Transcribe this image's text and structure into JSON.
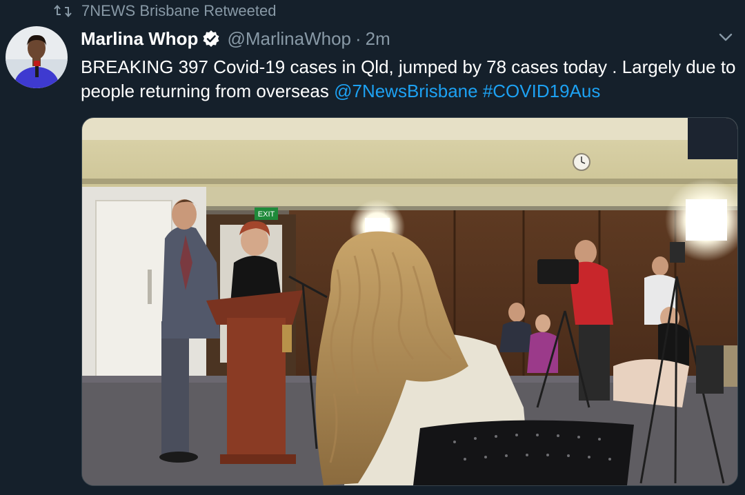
{
  "retweet": {
    "icon": "retweet-icon",
    "label": "7NEWS Brisbane Retweeted"
  },
  "author": {
    "display_name": "Marlina Whop",
    "verified_icon": "verified-badge-icon",
    "handle": "@MarlinaWhop",
    "separator": "·",
    "time": "2m"
  },
  "tweet": {
    "text_lead": "BREAKING 397 Covid-19 cases in Qld, jumped by 78 cases today . Largely due to people returning from overseas ",
    "mention": "@7NewsBrisbane",
    "hashtag": "#COVID19Aus"
  },
  "media_sign": {
    "exit": "EXIT"
  },
  "colors": {
    "background": "#15202b",
    "muted": "#8899a6",
    "link": "#1da1f2",
    "text": "#ffffff"
  },
  "icons": {
    "more": "chevron-down-icon"
  }
}
